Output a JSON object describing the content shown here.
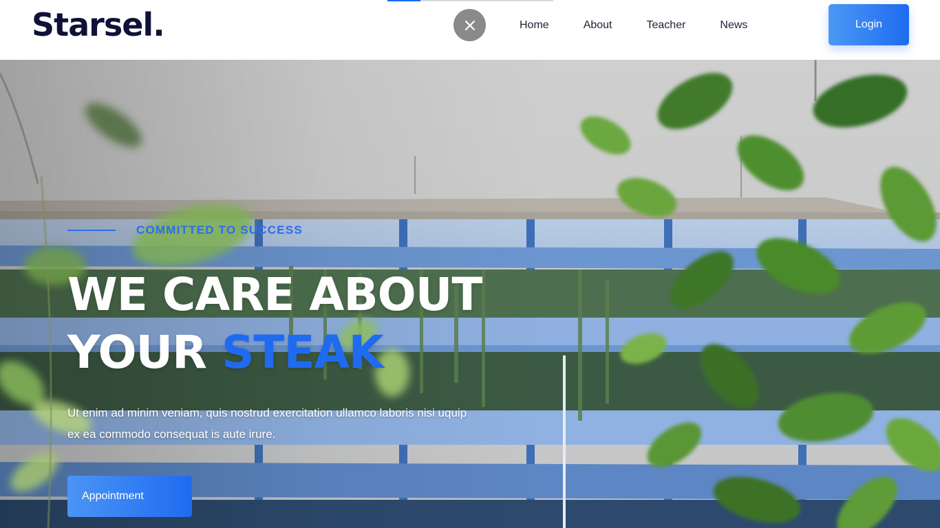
{
  "brand": {
    "logo": "Starsel."
  },
  "header": {
    "slider_progress": 0.2,
    "close_icon": "close-icon",
    "nav": [
      {
        "label": "Home"
      },
      {
        "label": "About"
      },
      {
        "label": "Teacher"
      },
      {
        "label": "News"
      }
    ],
    "login_label": "Login"
  },
  "hero": {
    "eyebrow": "COMMITTED TO SUCCESS",
    "headline_line1": "WE CARE ABOUT",
    "headline_line2_plain": "YOUR ",
    "headline_line2_accent": "STEAK",
    "description": "Ut enim ad minim veniam, quis nostrud exercitation ullamco laboris nisi uquip ex ea commodo consequat is aute irure.",
    "cta_label": "Appointment"
  },
  "colors": {
    "brand_dark": "#0f1238",
    "accent_blue": "#1f6bf0",
    "button_gradient_start": "#4b98f5",
    "button_gradient_end": "#1f6bf0",
    "close_button_gray": "#8a8a8a"
  }
}
